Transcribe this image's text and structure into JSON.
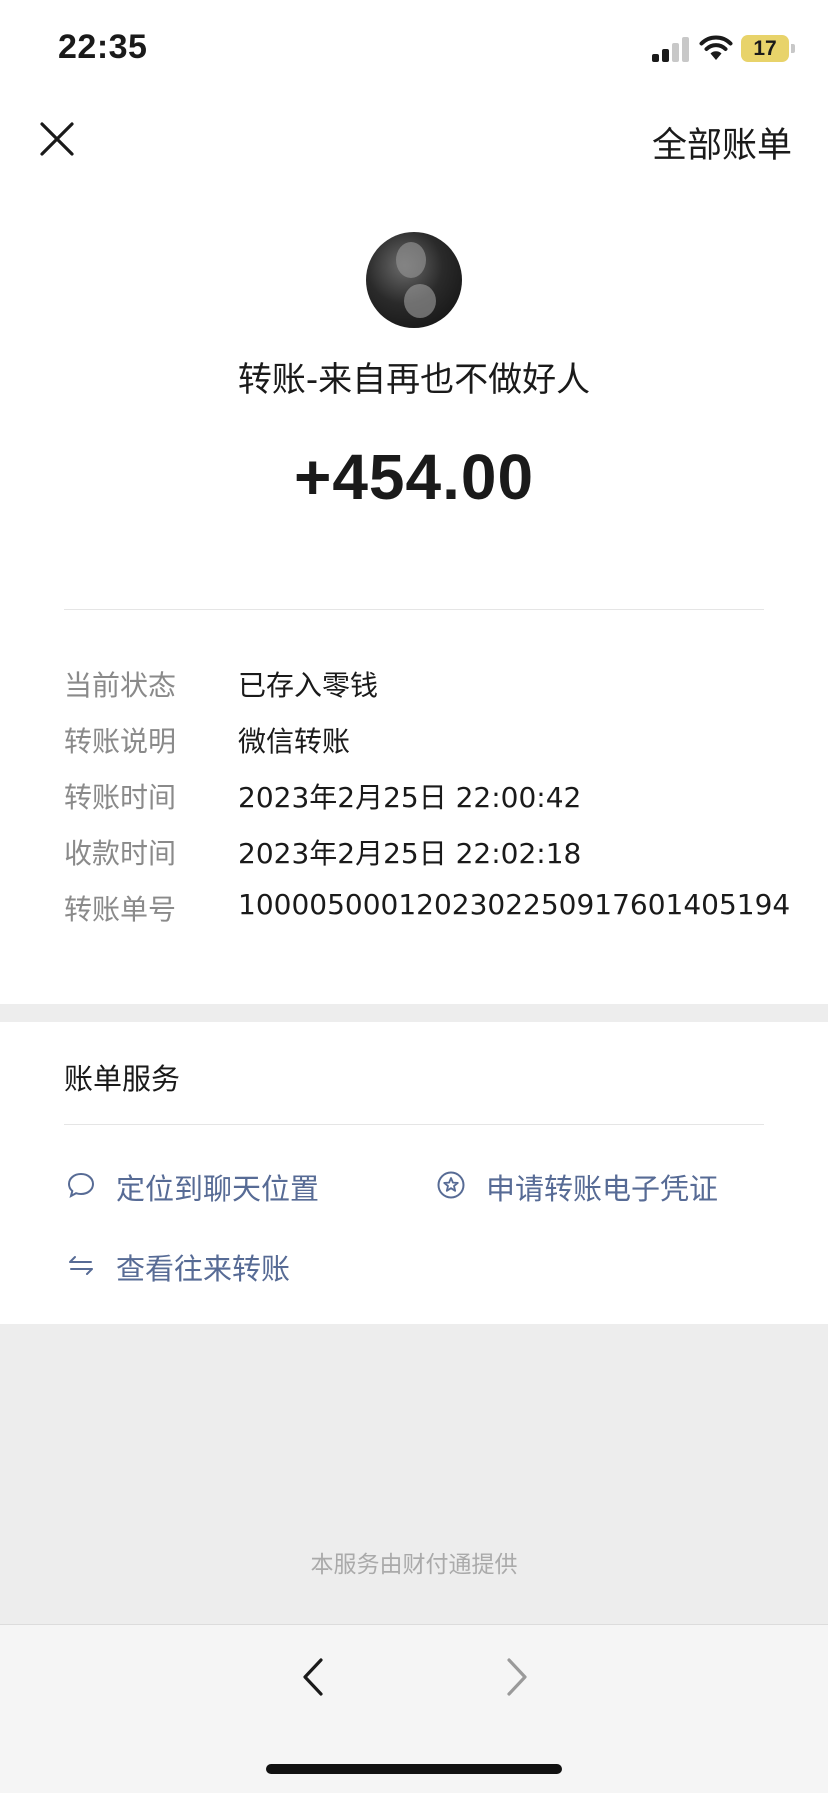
{
  "status_bar": {
    "time": "22:35",
    "battery": "17",
    "icons": [
      "signal-icon",
      "wifi-icon",
      "battery-icon"
    ]
  },
  "header": {
    "close_icon": "close-icon",
    "all_bills_label": "全部账单"
  },
  "transfer": {
    "title": "转账-来自再也不做好人",
    "amount": "+454.00"
  },
  "details": [
    {
      "label": "当前状态",
      "value": "已存入零钱"
    },
    {
      "label": "转账说明",
      "value": "微信转账"
    },
    {
      "label": "转账时间",
      "value": "2023年2月25日 22:00:42"
    },
    {
      "label": "收款时间",
      "value": "2023年2月25日 22:02:18"
    },
    {
      "label": "转账单号",
      "value": "1000050001202302250917601405194"
    }
  ],
  "services": {
    "title": "账单服务",
    "items": [
      {
        "label": "定位到聊天位置",
        "icon": "chat-bubble-icon"
      },
      {
        "label": "申请转账电子凭证",
        "icon": "star-badge-icon"
      },
      {
        "label": "查看往来转账",
        "icon": "transfer-arrows-icon"
      }
    ]
  },
  "footer": {
    "provider_text": "本服务由财付通提供"
  },
  "toolbar": {
    "back_icon": "chevron-left-icon",
    "forward_icon": "chevron-right-icon"
  },
  "colors": {
    "link": "#576b95",
    "label_gray": "#8a8a8a",
    "battery": "#e8d36a"
  }
}
